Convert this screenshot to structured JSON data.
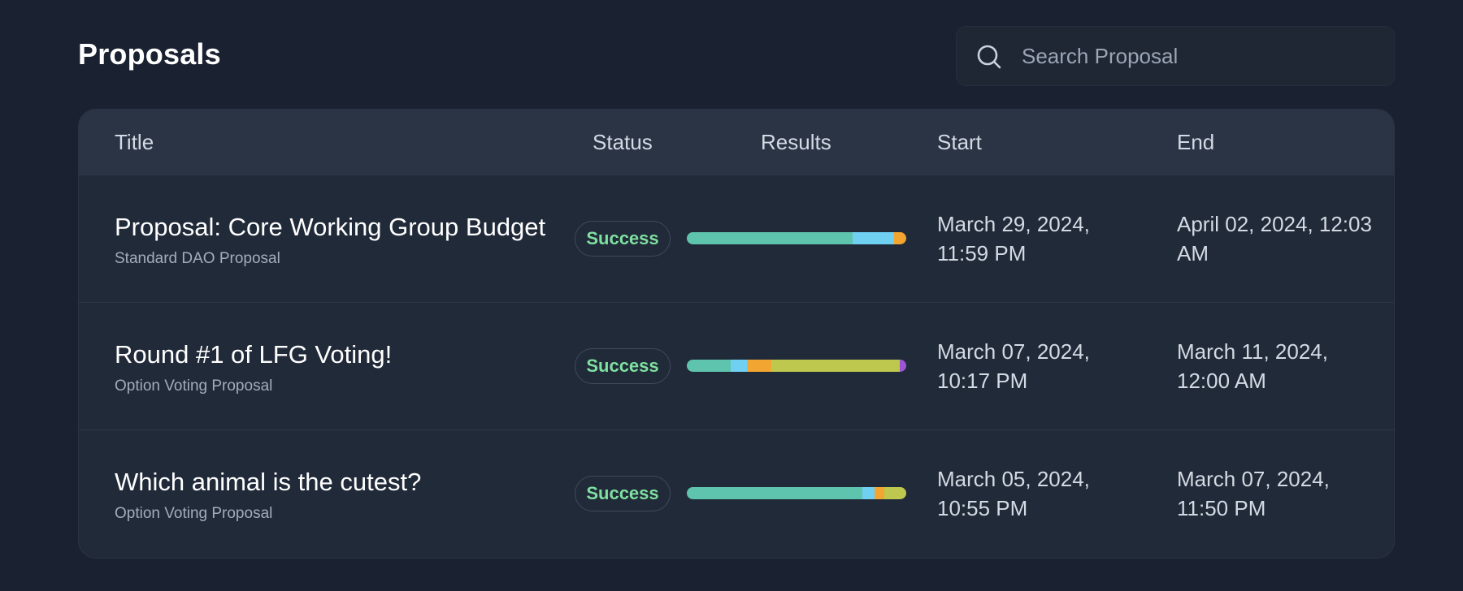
{
  "header": {
    "title": "Proposals",
    "search": {
      "icon": "search-icon",
      "placeholder": "Search Proposal",
      "value": ""
    }
  },
  "table": {
    "columns": {
      "title": "Title",
      "status": "Status",
      "results": "Results",
      "start": "Start",
      "end": "End"
    },
    "rows": [
      {
        "title": "Proposal: Core Working Group Budget",
        "subtitle": "Standard DAO Proposal",
        "status": "Success",
        "results": [
          {
            "fraction": 0.755,
            "color": "#5ec4ad"
          },
          {
            "fraction": 0.19,
            "color": "#6fd0f2"
          },
          {
            "fraction": 0.055,
            "color": "#f2a531"
          }
        ],
        "start_line1": "March 29, 2024,",
        "start_line2": "11:59 PM",
        "end_line1": "April 02, 2024, 12:03",
        "end_line2": "AM"
      },
      {
        "title": "Round #1 of LFG Voting!",
        "subtitle": "Option Voting Proposal",
        "status": "Success",
        "results": [
          {
            "fraction": 0.2,
            "color": "#5ec4ad"
          },
          {
            "fraction": 0.075,
            "color": "#6fd0f2"
          },
          {
            "fraction": 0.11,
            "color": "#f2a531"
          },
          {
            "fraction": 0.585,
            "color": "#bfc84e"
          },
          {
            "fraction": 0.03,
            "color": "#9b55d6"
          }
        ],
        "start_line1": "March 07, 2024,",
        "start_line2": "10:17 PM",
        "end_line1": "March 11, 2024,",
        "end_line2": "12:00 AM"
      },
      {
        "title": "Which animal is the cutest?",
        "subtitle": "Option Voting Proposal",
        "status": "Success",
        "results": [
          {
            "fraction": 0.8,
            "color": "#5ec4ad"
          },
          {
            "fraction": 0.055,
            "color": "#6fd0f2"
          },
          {
            "fraction": 0.045,
            "color": "#f2a531"
          },
          {
            "fraction": 0.1,
            "color": "#bfc84e"
          }
        ],
        "start_line1": "March 05, 2024,",
        "start_line2": "10:55 PM",
        "end_line1": "March 07, 2024,",
        "end_line2": "11:50 PM"
      }
    ]
  },
  "colors": {
    "background": "#1a2130",
    "card": "#212a39",
    "header_row": "#2a3445",
    "success": "#7fe0a0"
  }
}
